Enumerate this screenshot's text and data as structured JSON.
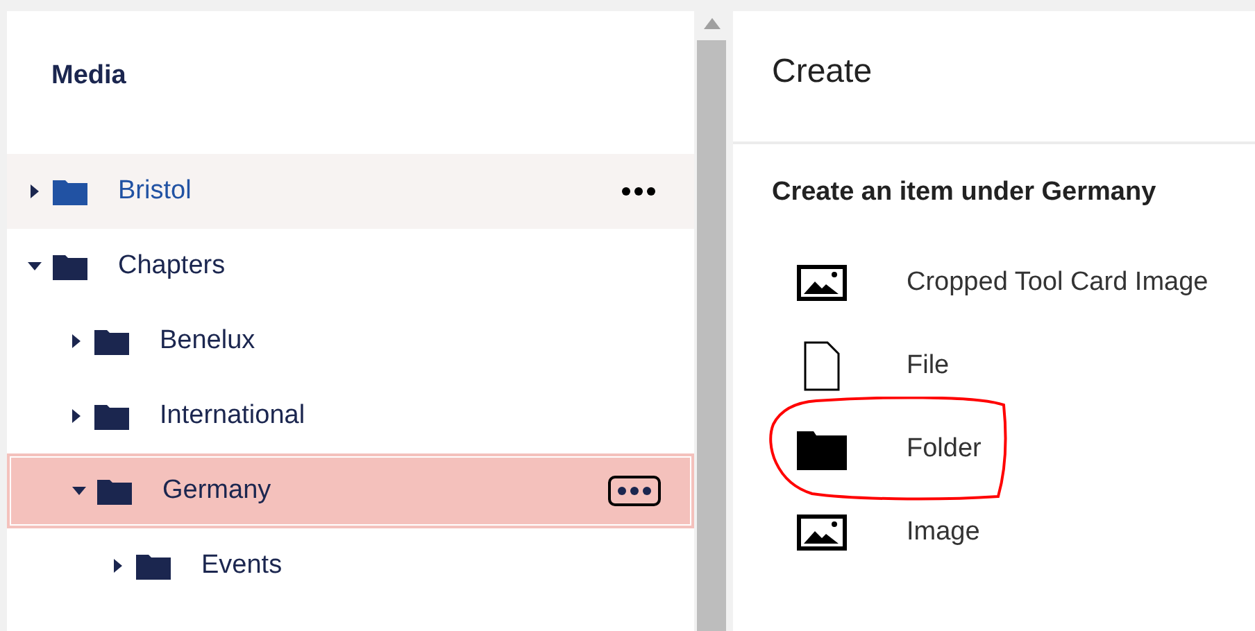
{
  "tree": {
    "title": "Media",
    "items": [
      {
        "label": "Bristol",
        "expanded": false,
        "hovered": true,
        "selected": false
      },
      {
        "label": "Chapters",
        "expanded": true,
        "hovered": false,
        "selected": false,
        "children": [
          {
            "label": "Benelux",
            "expanded": false,
            "hovered": false,
            "selected": false
          },
          {
            "label": "International",
            "expanded": false,
            "hovered": false,
            "selected": false
          },
          {
            "label": "Germany",
            "expanded": true,
            "hovered": false,
            "selected": true,
            "children": [
              {
                "label": "Events",
                "expanded": false,
                "hovered": false,
                "selected": false
              }
            ]
          }
        ]
      }
    ]
  },
  "create": {
    "title": "Create",
    "subtitle": "Create an item under Germany",
    "items": [
      {
        "kind": "image",
        "label": "Cropped Tool Card Image",
        "circled": false
      },
      {
        "kind": "file",
        "label": "File",
        "circled": false
      },
      {
        "kind": "folder",
        "label": "Folder",
        "circled": true
      },
      {
        "kind": "image",
        "label": "Image",
        "circled": false
      }
    ]
  }
}
